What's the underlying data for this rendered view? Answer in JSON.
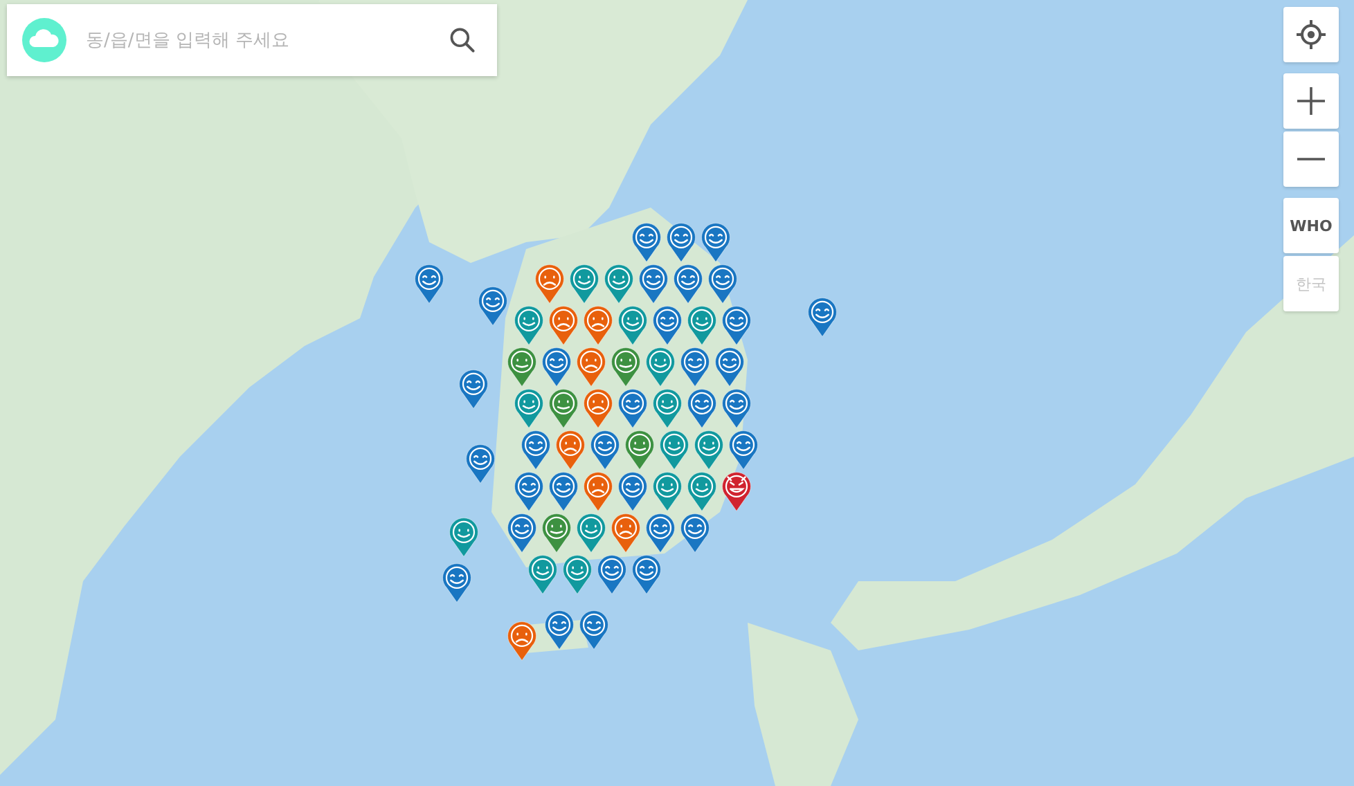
{
  "search": {
    "placeholder": "동/읍/면을 입력해 주세요"
  },
  "standards": [
    {
      "label": "WHO",
      "selected": true
    },
    {
      "label": "한국",
      "selected": false
    }
  ],
  "pins": [
    {
      "kind": "very-good",
      "color": "#1976c2"
    },
    {
      "kind": "very-good",
      "color": "#1976c2"
    },
    {
      "kind": "very-good",
      "color": "#1976c2"
    },
    {
      "kind": "very-good",
      "color": "#1976c2"
    },
    {
      "kind": "very-good",
      "color": "#1976c2"
    },
    {
      "kind": "very-good",
      "color": "#1976c2"
    },
    {
      "kind": "very-good",
      "color": "#1976c2"
    },
    {
      "kind": "very-good",
      "color": "#1976c2"
    },
    {
      "kind": "very-good",
      "color": "#1976c2"
    },
    {
      "kind": "very-good",
      "color": "#1976c2"
    },
    {
      "kind": "very-good",
      "color": "#1976c2"
    },
    {
      "kind": "very-good",
      "color": "#1976c2"
    },
    {
      "kind": "very-good",
      "color": "#1976c2"
    },
    {
      "kind": "very-good",
      "color": "#1976c2"
    },
    {
      "kind": "very-good",
      "color": "#1976c2"
    },
    {
      "kind": "very-good",
      "color": "#1976c2"
    },
    {
      "kind": "very-good",
      "color": "#1976c2"
    },
    {
      "kind": "very-good",
      "color": "#1976c2"
    },
    {
      "kind": "very-good",
      "color": "#1976c2"
    },
    {
      "kind": "very-good",
      "color": "#1976c2"
    },
    {
      "kind": "very-good",
      "color": "#1976c2"
    },
    {
      "kind": "very-good",
      "color": "#1976c2"
    },
    {
      "kind": "very-good",
      "color": "#1976c2"
    },
    {
      "kind": "very-good",
      "color": "#1976c2"
    },
    {
      "kind": "very-good",
      "color": "#1976c2"
    },
    {
      "kind": "very-good",
      "color": "#1976c2"
    },
    {
      "kind": "very-good",
      "color": "#1976c2"
    },
    {
      "kind": "very-good",
      "color": "#1976c2"
    },
    {
      "kind": "very-good",
      "color": "#1976c2"
    },
    {
      "kind": "very-good",
      "color": "#1976c2"
    },
    {
      "kind": "very-good",
      "color": "#1976c2"
    },
    {
      "kind": "very-good",
      "color": "#1976c2"
    },
    {
      "kind": "very-good",
      "color": "#1976c2"
    },
    {
      "kind": "good",
      "color": "#11999e"
    },
    {
      "kind": "good",
      "color": "#11999e"
    },
    {
      "kind": "good",
      "color": "#11999e"
    },
    {
      "kind": "good",
      "color": "#11999e"
    },
    {
      "kind": "good",
      "color": "#11999e"
    },
    {
      "kind": "good",
      "color": "#11999e"
    },
    {
      "kind": "good",
      "color": "#11999e"
    },
    {
      "kind": "good",
      "color": "#11999e"
    },
    {
      "kind": "good",
      "color": "#11999e"
    },
    {
      "kind": "good",
      "color": "#11999e"
    },
    {
      "kind": "good",
      "color": "#11999e"
    },
    {
      "kind": "good",
      "color": "#11999e"
    },
    {
      "kind": "good",
      "color": "#11999e"
    },
    {
      "kind": "good",
      "color": "#11999e"
    },
    {
      "kind": "good",
      "color": "#11999e"
    },
    {
      "kind": "good",
      "color": "#11999e"
    },
    {
      "kind": "normal",
      "color": "#3d9141"
    },
    {
      "kind": "normal",
      "color": "#3d9141"
    },
    {
      "kind": "normal",
      "color": "#3d9141"
    },
    {
      "kind": "normal",
      "color": "#3d9141"
    },
    {
      "kind": "normal",
      "color": "#3d9141"
    },
    {
      "kind": "bad",
      "color": "#e8600c"
    },
    {
      "kind": "bad",
      "color": "#e8600c"
    },
    {
      "kind": "bad",
      "color": "#e8600c"
    },
    {
      "kind": "bad",
      "color": "#e8600c"
    },
    {
      "kind": "bad",
      "color": "#e8600c"
    },
    {
      "kind": "bad",
      "color": "#e8600c"
    },
    {
      "kind": "bad",
      "color": "#e8600c"
    },
    {
      "kind": "bad",
      "color": "#e8600c"
    },
    {
      "kind": "bad",
      "color": "#e8600c"
    },
    {
      "kind": "very-bad",
      "color": "#d0232f"
    }
  ]
}
